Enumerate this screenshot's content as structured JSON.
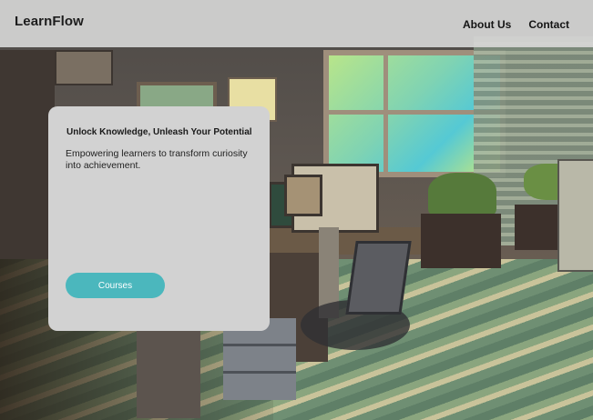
{
  "header": {
    "brand": "LearnFlow",
    "nav": [
      {
        "label": "About Us"
      },
      {
        "label": "Contact"
      }
    ]
  },
  "hero": {
    "title": "Unlock Knowledge, Unleash Your Potential",
    "body": "Empowering learners to transform curiosity into achievement.",
    "cta_label": "Courses"
  },
  "colors": {
    "header_bg": "#d6d6d6",
    "card_bg": "#d2d2d2",
    "cta_bg": "#4bb7bd",
    "cta_text": "#ffffff"
  },
  "background": {
    "icon": "pixel-art-office-scene"
  }
}
